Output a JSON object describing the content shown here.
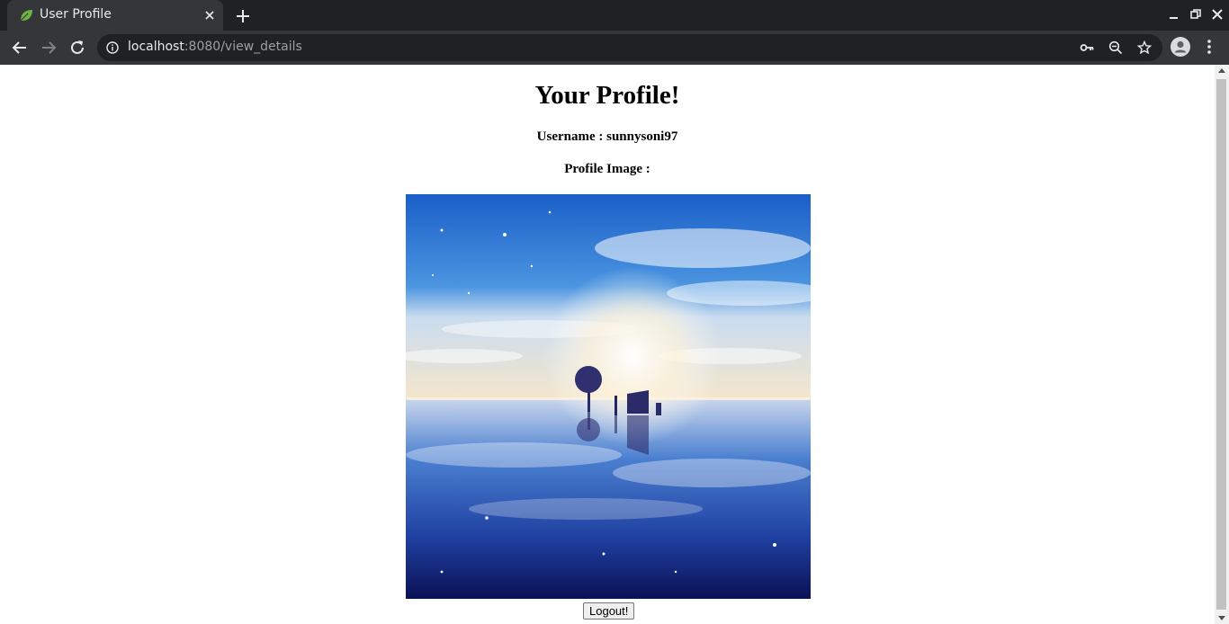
{
  "browser": {
    "tab_title": "User Profile",
    "url_host": "localhost",
    "url_rest": ":8080/view_details",
    "favicon": "leaf-icon",
    "accent_color": "#6db33f"
  },
  "page": {
    "heading": "Your Profile!",
    "username_line": "Username : sunnysoni97",
    "profile_image_label": "Profile Image :",
    "logout_label": "Logout!"
  }
}
